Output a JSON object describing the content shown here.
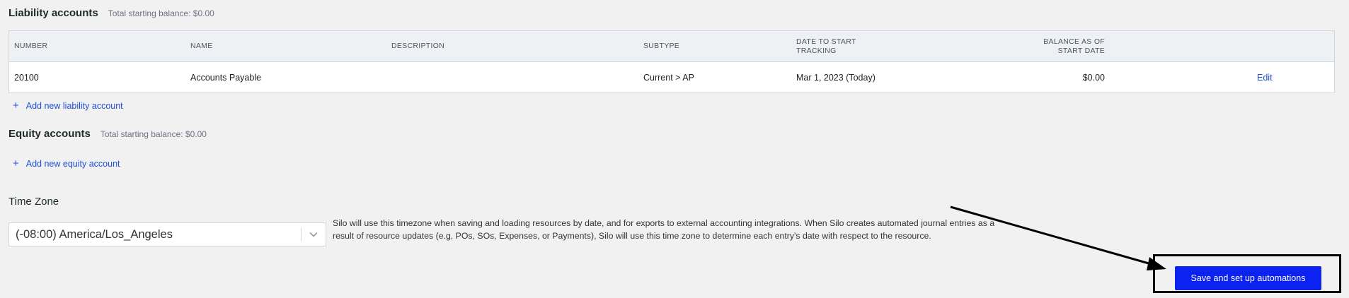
{
  "liability": {
    "title": "Liability accounts",
    "total": "Total starting balance: $0.00",
    "columns": {
      "number": "NUMBER",
      "name": "NAME",
      "description": "DESCRIPTION",
      "subtype": "SUBTYPE",
      "date_line1": "DATE TO START",
      "date_line2": "TRACKING",
      "balance_line1": "BALANCE AS OF",
      "balance_line2": "START DATE"
    },
    "rows": [
      {
        "number": "20100",
        "name": "Accounts Payable",
        "description": "",
        "subtype": "Current > AP",
        "date": "Mar 1, 2023 (Today)",
        "balance": "$0.00",
        "action": "Edit"
      }
    ],
    "add_label": "Add new liability account"
  },
  "equity": {
    "title": "Equity accounts",
    "total": "Total starting balance: $0.00",
    "add_label": "Add new equity account"
  },
  "timezone": {
    "label": "Time Zone",
    "value": "(-08:00) America/Los_Angeles",
    "description": "Silo will use this timezone when saving and loading resources by date, and for exports to external accounting integrations. When Silo creates automated journal entries as a result of resource updates (e.g, POs, SOs, Expenses, or Payments), Silo will use this time zone to determine each entry's date with respect to the resource."
  },
  "actions": {
    "save_label": "Save and set up automations"
  },
  "icons": {
    "plus": "plus-icon",
    "chevron": "chevron-down-icon",
    "annotation_arrow": "arrow-icon"
  },
  "colors": {
    "background": "#f1f1f1",
    "link": "#1f4fd6",
    "primary_button": "#0b22f0",
    "highlight_border": "#000000"
  }
}
